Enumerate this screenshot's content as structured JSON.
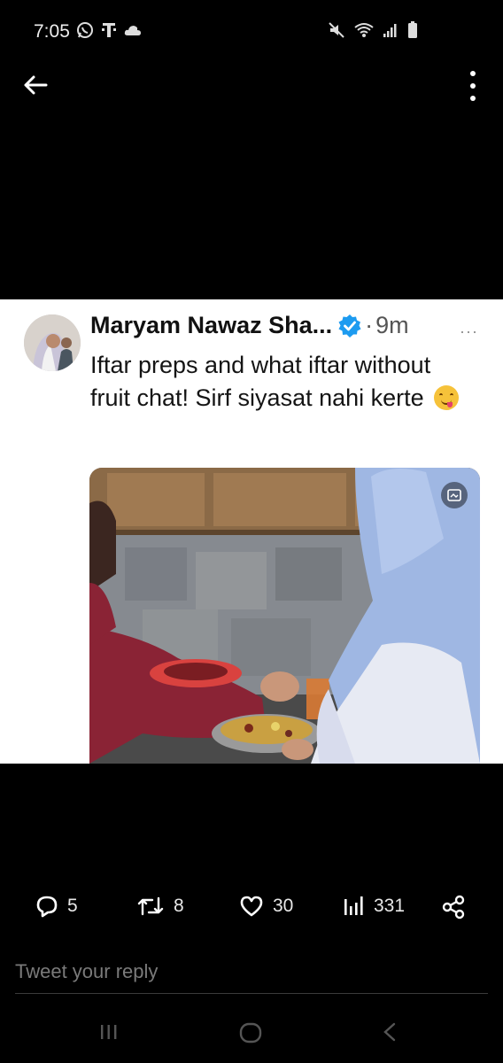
{
  "status_bar": {
    "time": "7:05",
    "left_icons": [
      "whatsapp-icon",
      "tmobile-icon",
      "cloud-icon"
    ],
    "right_icons": [
      "mute-icon",
      "wifi-icon",
      "signal-icon",
      "battery-icon"
    ]
  },
  "navigation": {
    "back_icon": "arrow-left-icon",
    "more_icon": "vertical-dots-icon"
  },
  "tweet": {
    "author_name": "Maryam Nawaz Sha...",
    "verified_icon": "verified-badge-icon",
    "separator": "·",
    "time": "9m",
    "more_label": "···",
    "text": "Iftar preps and what iftar without fruit chat! Sirf siyasat nahi kerte",
    "emoji": "face-savoring-food-emoji",
    "media_badge_icon": "image-badge-icon"
  },
  "actions": {
    "replies": "5",
    "retweets": "8",
    "likes": "30",
    "views": "331",
    "share_icon": "share-icon"
  },
  "reply": {
    "placeholder": "Tweet your reply"
  },
  "android_nav": {
    "recents_icon": "recents-icon",
    "home_icon": "home-icon",
    "back_icon": "back-chevron-icon"
  },
  "colors": {
    "background": "#000000",
    "card": "#ffffff",
    "verified": "#1d9bf0",
    "text_dark": "#141414",
    "placeholder": "#7a7a7a"
  }
}
